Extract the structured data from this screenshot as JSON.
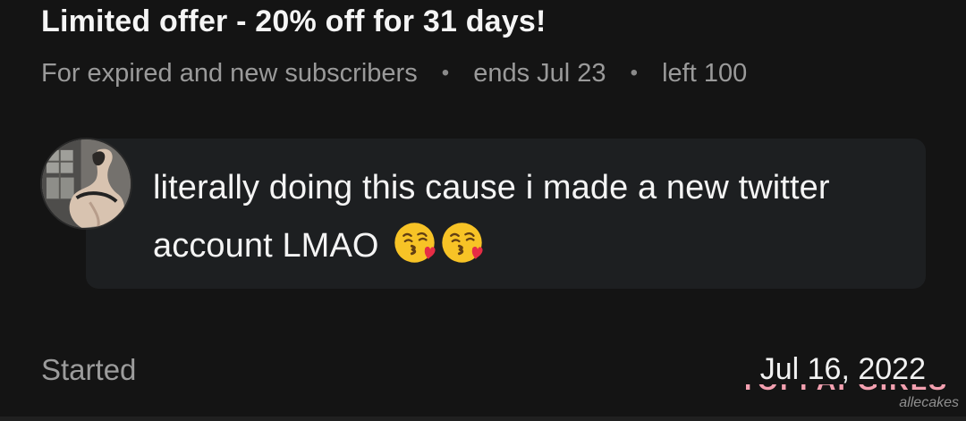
{
  "offer": {
    "title": "Limited offer - 20% off for 31 days!",
    "audience": "For expired and new subscribers",
    "ends": "ends Jul 23",
    "left": "left 100",
    "separator": "•"
  },
  "message": {
    "text": "literally doing this cause i made a new twitter account LMAO",
    "emojis": [
      "kissing-face-emoji",
      "kissing-face-emoji"
    ]
  },
  "status": {
    "started_label": "Started",
    "started_date": "Jul 16, 2022"
  },
  "watermark": {
    "brand_text": "TOPFAPGIRLS",
    "username": "allecakes"
  },
  "colors": {
    "background": "#141414",
    "bubble": "#1d1f21",
    "muted_text": "#9a9a9a",
    "primary_text": "#f4f4f4",
    "watermark_pink": "#f3a0b0"
  }
}
